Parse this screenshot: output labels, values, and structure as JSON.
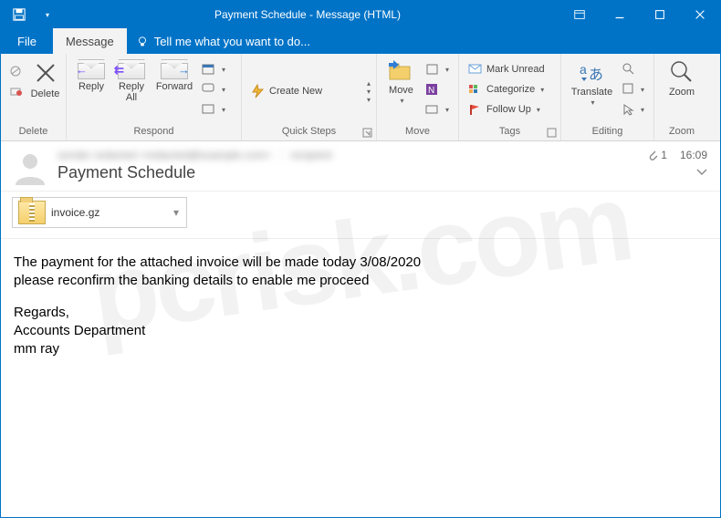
{
  "titlebar": {
    "title": "Payment Schedule - Message (HTML)"
  },
  "tabs": {
    "file": "File",
    "message": "Message",
    "tell_me": "Tell me what you want to do..."
  },
  "ribbon": {
    "delete_group": "Delete",
    "delete": "Delete",
    "respond_group": "Respond",
    "reply": "Reply",
    "reply_all": "Reply All",
    "forward": "Forward",
    "quicksteps_group": "Quick Steps",
    "create_new": "Create New",
    "move_group": "Move",
    "move": "Move",
    "tags_group": "Tags",
    "mark_unread": "Mark Unread",
    "categorize": "Categorize",
    "follow_up": "Follow Up",
    "editing_group": "Editing",
    "translate": "Translate",
    "zoom_group": "Zoom",
    "zoom": "Zoom"
  },
  "header": {
    "from": "sender redacted  <redacted@example.com>",
    "to": "recipient",
    "subject": "Payment Schedule",
    "attachment_count": "1",
    "time": "16:09"
  },
  "attachment": {
    "name": "invoice.gz"
  },
  "body": {
    "line1": "The payment for the attached invoice will be made today 3/08/2020",
    "line2": "please reconfirm the banking details to enable me proceed",
    "line3": "Regards,",
    "line4": "Accounts Department",
    "line5": "mm ray"
  },
  "watermark": "pcrisk.com"
}
